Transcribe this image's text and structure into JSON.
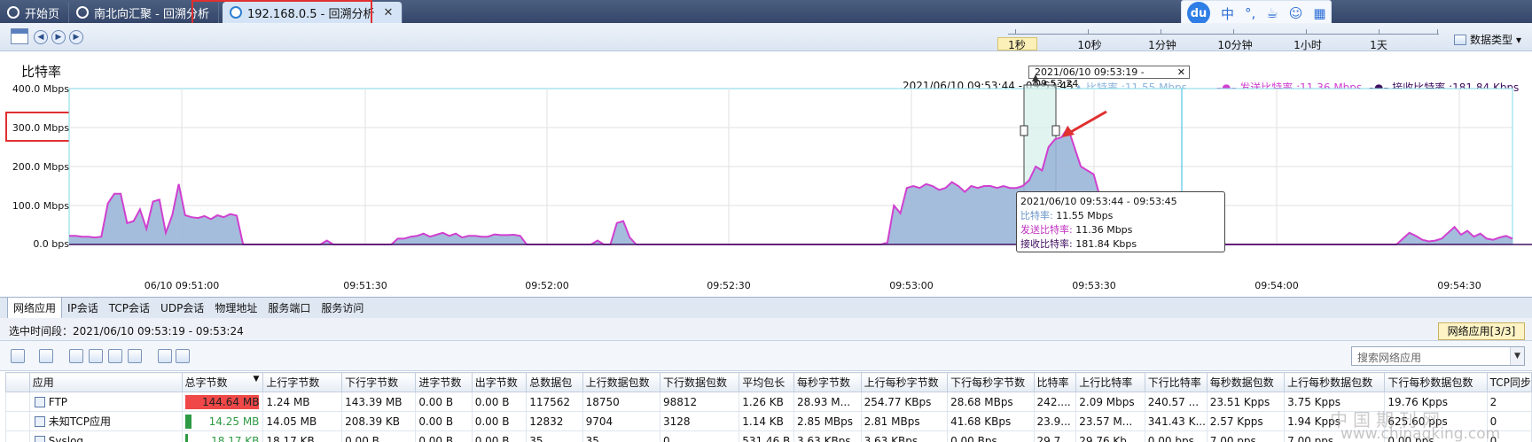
{
  "tabs": [
    {
      "label": "开始页"
    },
    {
      "label": "南北向汇聚 - 回溯分析"
    },
    {
      "label": "192.168.0.5 - 回溯分析"
    }
  ],
  "ime": {
    "logo": "du",
    "items": [
      "中",
      "°,"
    ]
  },
  "timescale": {
    "labels": [
      "1秒",
      "10秒",
      "1分钟",
      "10分钟",
      "1小时",
      "1天"
    ],
    "selected": "1秒"
  },
  "data_type_label": "数据类型",
  "chart": {
    "title": "比特率",
    "range_box": "2021/06/10  09:53:19 - 09:53:24",
    "header_time": "2021/06/10   09:53:44 - 09:53:45",
    "legend": [
      {
        "label": "比特率 :11.55 Mbps",
        "color": "#8fb4dc"
      },
      {
        "label": "发送比特率 :11.36 Mbps",
        "color": "#d040d0"
      },
      {
        "label": "接收比特率 :181.84 Kbps",
        "color": "#401060"
      }
    ],
    "tooltip": {
      "time": "2021/06/10  09:53:44 - 09:53:45",
      "rows": [
        {
          "k": "比特率:",
          "v": "11.55 Mbps",
          "color": "#6a95c8"
        },
        {
          "k": "发送比特率:",
          "v": "11.36 Mbps",
          "color": "#c030c0"
        },
        {
          "k": "接收比特率:",
          "v": "181.84 Kbps",
          "color": "#401060"
        }
      ]
    }
  },
  "chart_data": {
    "type": "area",
    "title": "比特率",
    "y_tick_labels": [
      "400.0 Mbps",
      "300.0 Mbps",
      "200.0 Mbps",
      "100.0 Mbps",
      "0.0 bps"
    ],
    "ylim": [
      0,
      400
    ],
    "x_tick_labels": [
      "06/10 09:51:00",
      "09:51:30",
      "09:52:00",
      "09:52:30",
      "09:53:00",
      "09:53:30",
      "09:54:00",
      "09:54:30"
    ],
    "grid": true,
    "series": [
      {
        "name": "发送比特率",
        "color": "#d040d0",
        "values": [
          22,
          22,
          20,
          20,
          18,
          20,
          105,
          130,
          130,
          55,
          60,
          90,
          40,
          110,
          115,
          30,
          75,
          155,
          75,
          70,
          68,
          73,
          65,
          75,
          70,
          78,
          74,
          0,
          0,
          0,
          0,
          0,
          0,
          0,
          0,
          0,
          0,
          0,
          0,
          0,
          10,
          0,
          0,
          0,
          0,
          0,
          0,
          0,
          0,
          0,
          0,
          15,
          15,
          20,
          22,
          28,
          20,
          25,
          30,
          22,
          28,
          18,
          22,
          22,
          20,
          20,
          26,
          24,
          24,
          25,
          22,
          0,
          0,
          0,
          0,
          0,
          0,
          0,
          0,
          0,
          0,
          0,
          10,
          0,
          0,
          55,
          60,
          18,
          0,
          0,
          0,
          0,
          0,
          0,
          0,
          0,
          0,
          0,
          0,
          0,
          0,
          0,
          0,
          0,
          0,
          0,
          0,
          0,
          0,
          0,
          0,
          0,
          0,
          0,
          0,
          0,
          0,
          0,
          0,
          0,
          0,
          0,
          0,
          0,
          0,
          0,
          0,
          5,
          100,
          80,
          145,
          150,
          145,
          155,
          150,
          140,
          145,
          160,
          150,
          135,
          150,
          145,
          150,
          150,
          145,
          150,
          145,
          145,
          150,
          165,
          200,
          190,
          250,
          270,
          275,
          300,
          250,
          200,
          190,
          180,
          120,
          60,
          40,
          30,
          30,
          20,
          20,
          15,
          20,
          10,
          0,
          0,
          0,
          0,
          0,
          0,
          0,
          0,
          0,
          0,
          0,
          0,
          0,
          0,
          0,
          0,
          0,
          0,
          0,
          0,
          0,
          0,
          0,
          0,
          0,
          0,
          0,
          0,
          0,
          0,
          0,
          0,
          0,
          0,
          0,
          0,
          0,
          15,
          30,
          22,
          12,
          8,
          10,
          15,
          30,
          45,
          25,
          35,
          20,
          28,
          15,
          12,
          18,
          22,
          15
        ]
      },
      {
        "name": "接收比特率",
        "color": "#401060",
        "values": [
          0,
          0,
          0,
          0,
          0,
          0,
          0,
          0,
          0,
          0,
          0,
          0,
          0,
          0,
          0,
          0,
          0,
          0,
          0,
          0,
          0,
          0,
          0,
          0,
          0,
          0,
          0,
          0,
          0,
          0,
          0,
          0,
          0,
          0,
          0,
          0,
          0,
          0,
          0,
          0,
          0,
          0,
          0,
          0,
          0,
          0,
          0,
          0,
          0,
          0,
          0,
          0,
          0,
          0,
          0,
          0,
          0,
          0,
          0,
          0,
          0,
          0,
          0,
          0,
          0,
          0,
          0,
          0,
          0,
          0,
          0,
          0,
          0,
          0,
          0,
          0,
          0,
          0,
          0,
          0,
          0,
          0,
          0,
          0,
          0,
          0,
          0,
          0,
          0,
          0,
          0,
          0,
          0,
          0,
          0,
          0,
          0,
          0,
          0,
          0,
          0,
          0,
          0,
          0,
          0,
          0,
          0,
          0,
          0,
          0,
          0,
          0,
          0,
          0,
          0,
          0,
          0,
          0,
          0,
          0,
          0,
          0,
          0,
          0,
          0,
          0,
          0,
          0,
          0,
          0,
          0,
          0,
          0,
          0,
          0,
          0,
          0,
          0,
          0,
          0,
          0,
          0,
          0,
          0,
          0,
          0,
          0,
          0,
          0,
          0,
          0,
          0,
          0,
          0,
          0,
          0,
          0,
          0,
          0,
          0,
          0,
          0,
          0,
          0,
          0,
          0,
          0,
          0,
          0,
          0,
          0,
          0,
          0,
          0,
          0,
          0,
          0,
          0,
          0,
          0,
          0,
          0,
          0,
          0,
          0,
          0,
          0,
          0,
          0,
          0,
          0,
          0,
          0,
          0,
          0,
          0,
          0,
          0,
          0,
          0,
          0,
          0,
          0,
          0,
          0,
          0,
          0,
          0,
          0,
          0,
          0,
          0,
          0,
          0,
          0,
          0,
          0,
          0,
          0,
          0,
          0,
          0,
          0,
          0,
          0,
          0,
          0,
          0,
          0
        ]
      }
    ]
  },
  "bottom": {
    "tabs": [
      "网络应用",
      "IP会话",
      "TCP会话",
      "UDP会话",
      "物理地址",
      "服务端口",
      "服务访问"
    ],
    "selected_range": "选中时间段：2021/06/10  09:53:19 - 09:53:24",
    "pill": "网络应用[3/3]",
    "search_placeholder": "搜索网络应用",
    "table": {
      "columns": [
        "应用",
        "总字节数",
        "上行字节数",
        "下行字节数",
        "进字节数",
        "出字节数",
        "总数据包",
        "上行数据包数",
        "下行数据包数",
        "平均包长",
        "每秒字节数",
        "上行每秒字节数",
        "下行每秒字节数",
        "比特率",
        "上行比特率",
        "下行比特率",
        "每秒数据包数",
        "上行每秒数据包数",
        "下行每秒数据包数",
        "TCP同步"
      ],
      "rows": [
        {
          "cells": [
            "FTP",
            "144.64 MB",
            "1.24 MB",
            "143.39 MB",
            "0.00 B",
            "0.00 B",
            "117562",
            "18750",
            "98812",
            "1.26 KB",
            "28.93 M...",
            "254.77 KBps",
            "28.68 MBps",
            "242....",
            "2.09 Mbps",
            "240.57 ...",
            "23.51 Kpps",
            "3.75 Kpps",
            "19.76 Kpps",
            "2"
          ],
          "fill_fraction": 0.95,
          "fill_color": "#f04848"
        },
        {
          "cells": [
            "未知TCP应用",
            "14.25 MB",
            "14.05 MB",
            "208.39 KB",
            "0.00 B",
            "0.00 B",
            "12832",
            "9704",
            "3128",
            "1.14 KB",
            "2.85 MBps",
            "2.81 MBps",
            "41.68 KBps",
            "23.9...",
            "23.57 M...",
            "341.43 K...",
            "2.57 Kpps",
            "1.94 Kpps",
            "625.60 pps",
            "0"
          ],
          "fill_fraction": 0.08,
          "fill_color": "#2e9a44"
        },
        {
          "cells": [
            "Syslog",
            "18.17 KB",
            "18.17 KB",
            "0.00 B",
            "0.00 B",
            "0.00 B",
            "35",
            "35",
            "0",
            "531.46 B",
            "3.63 KBps",
            "3.63 KBps",
            "0.00 Bps",
            "29.7...",
            "29.76 Kb...",
            "0.00 bps",
            "7.00 pps",
            "7.00 pps",
            "0.00 pps",
            "0"
          ],
          "fill_fraction": 0.01,
          "fill_color": "#2e9a44"
        }
      ]
    }
  },
  "watermark": {
    "text1": "中国期刊网",
    "text2": "www.chinaqking.com"
  }
}
